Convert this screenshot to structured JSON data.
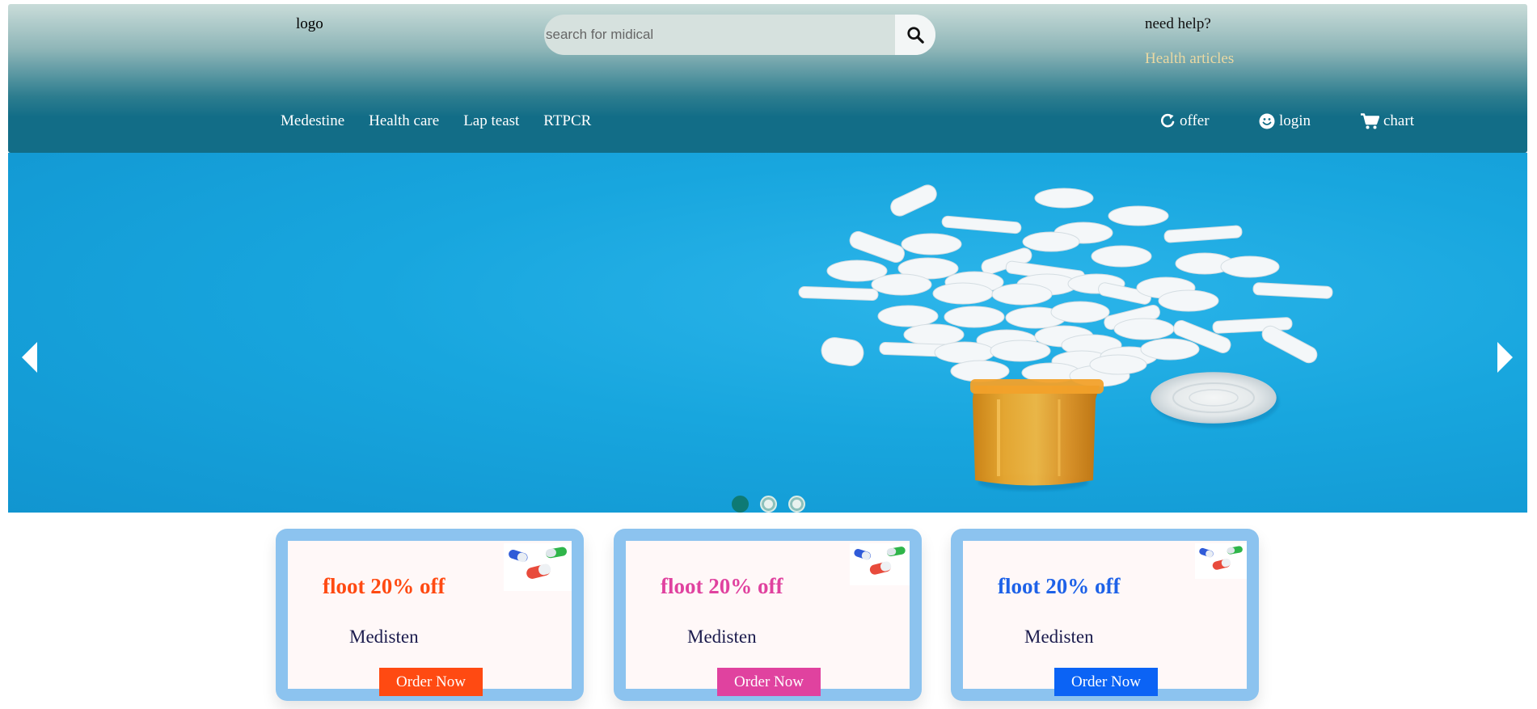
{
  "header": {
    "logo": "logo",
    "search": {
      "placeholder": "search for midical",
      "value": ""
    },
    "help": "need help?",
    "health_link": "Health articles",
    "nav": [
      "Medestine",
      "Health care",
      "Lap teast",
      "RTPCR"
    ],
    "actions": {
      "offer": "offer",
      "login": "login",
      "chart": "chart"
    }
  },
  "carousel": {
    "slides": 3,
    "active_index": 0
  },
  "cards": [
    {
      "title": "floot 20% off",
      "subtitle": "Medisten",
      "button": "Order Now",
      "accent": "#ff4a12"
    },
    {
      "title": "floot 20% off",
      "subtitle": "Medisten",
      "button": "Order Now",
      "accent": "#e0429f"
    },
    {
      "title": "floot 20% off",
      "subtitle": "Medisten",
      "button": "Order Now",
      "accent": "#1e62e8"
    }
  ],
  "colors": {
    "header_teal": "#126d87",
    "hero_blue": "#18a6de",
    "card_border": "#8cc3ef",
    "orange_button": "#ff4a12",
    "pink_button": "#e0429f",
    "blue_button": "#0b63f5",
    "link_gold": "#ead8a2"
  },
  "icons": {
    "search": "search-icon",
    "offer": "refresh-icon",
    "login": "smiley-icon",
    "chart": "cart-icon",
    "prev": "chevron-left-icon",
    "next": "chevron-right-icon"
  }
}
